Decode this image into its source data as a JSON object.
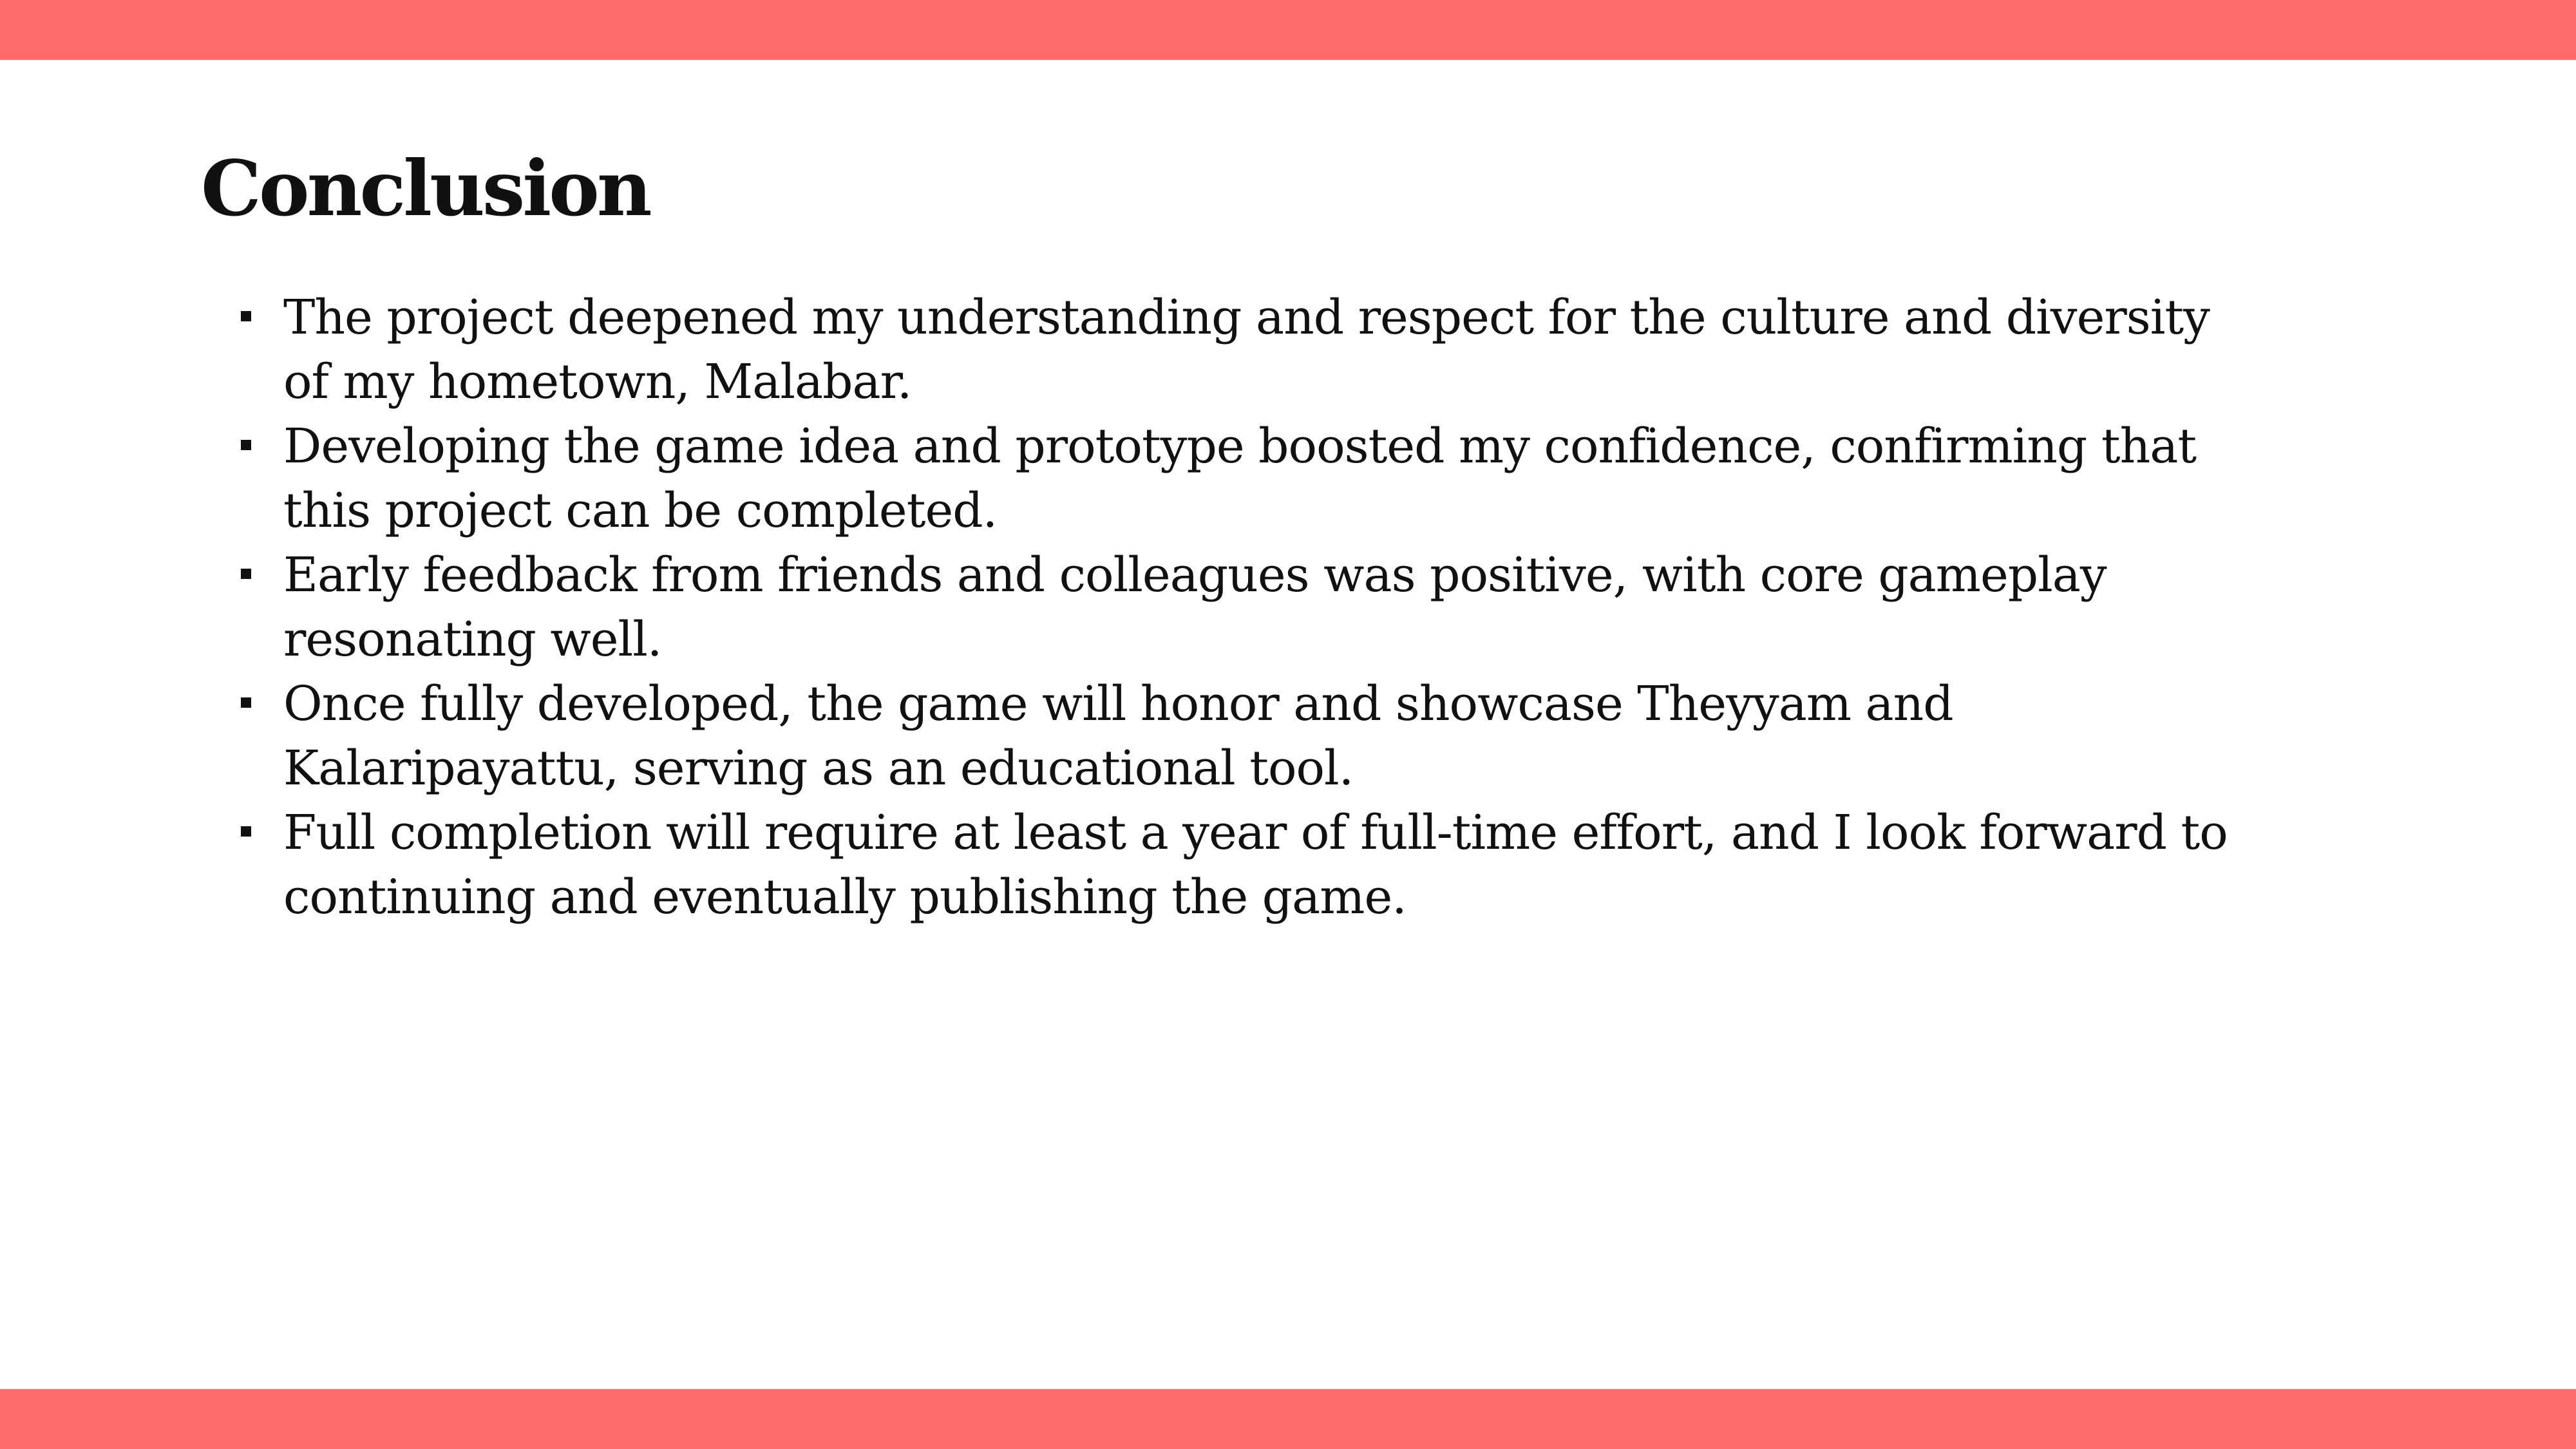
{
  "colors": {
    "accent_band": "#FF6B6B",
    "text": "#111111",
    "background": "#FFFFFF"
  },
  "slide": {
    "title": "Conclusion",
    "bullets": [
      "The project deepened my understanding and respect for the culture and diversity of my hometown, Malabar.",
      "Developing the game idea and prototype boosted my confidence, confirming that this project can be completed.",
      "Early feedback from friends and colleagues was positive, with core gameplay resonating well.",
      "Once fully developed, the game will honor and showcase Theyyam and Kalaripayattu, serving as an educational tool.",
      "Full completion will require at least a year of full-time effort, and I look forward to continuing and eventually publishing the game."
    ]
  }
}
